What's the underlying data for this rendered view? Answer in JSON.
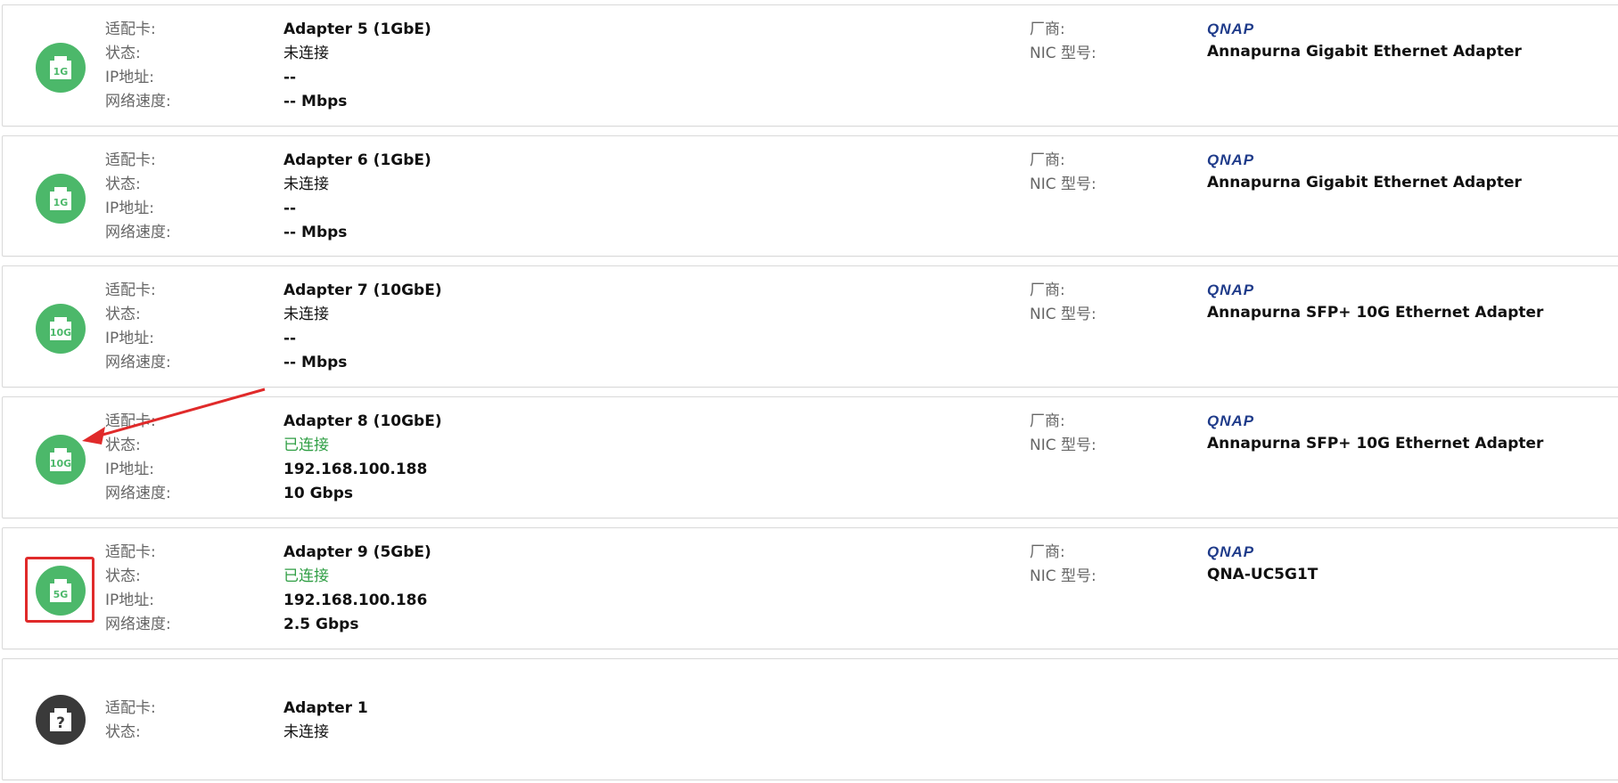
{
  "labels": {
    "adapter": "适配卡:",
    "status": "状态:",
    "ip": "IP地址:",
    "speed": "网络速度:",
    "vendor": "厂商:",
    "nic_model": "NIC 型号:"
  },
  "colors": {
    "icon_green": "#4cb86a",
    "icon_unknown": "#3a3a3a",
    "connected_text": "#2f9e44",
    "vendor_logo": "#1f3b8a",
    "annotation_red": "#e02a2a"
  },
  "adapters": [
    {
      "name": "Adapter 5 (1GbE)",
      "status": "未连接",
      "ip": "--",
      "speed": "-- Mbps",
      "vendor": "QNAP",
      "nic_model": "Annapurna Gigabit Ethernet Adapter",
      "icon": "ethernet-port-icon",
      "icon_text": "1G"
    },
    {
      "name": "Adapter 6 (1GbE)",
      "status": "未连接",
      "ip": "--",
      "speed": "-- Mbps",
      "vendor": "QNAP",
      "nic_model": "Annapurna Gigabit Ethernet Adapter",
      "icon": "ethernet-port-icon",
      "icon_text": "1G"
    },
    {
      "name": "Adapter 7 (10GbE)",
      "status": "未连接",
      "ip": "--",
      "speed": "-- Mbps",
      "vendor": "QNAP",
      "nic_model": "Annapurna SFP+ 10G Ethernet Adapter",
      "icon": "ethernet-port-icon",
      "icon_text": "10G"
    },
    {
      "name": "Adapter 8 (10GbE)",
      "status": "已连接",
      "ip": "192.168.100.188",
      "speed": "10 Gbps",
      "vendor": "QNAP",
      "nic_model": "Annapurna SFP+ 10G Ethernet Adapter",
      "icon": "ethernet-port-icon",
      "icon_text": "10G"
    },
    {
      "name": "Adapter 9 (5GbE)",
      "status": "已连接",
      "ip": "192.168.100.186",
      "speed": "2.5 Gbps",
      "vendor": "QNAP",
      "nic_model": "QNA-UC5G1T",
      "icon": "ethernet-port-icon",
      "icon_text": "5G"
    },
    {
      "name": "Adapter 1",
      "status": "未连接",
      "icon": "unknown-port-icon",
      "icon_text": "?"
    }
  ]
}
